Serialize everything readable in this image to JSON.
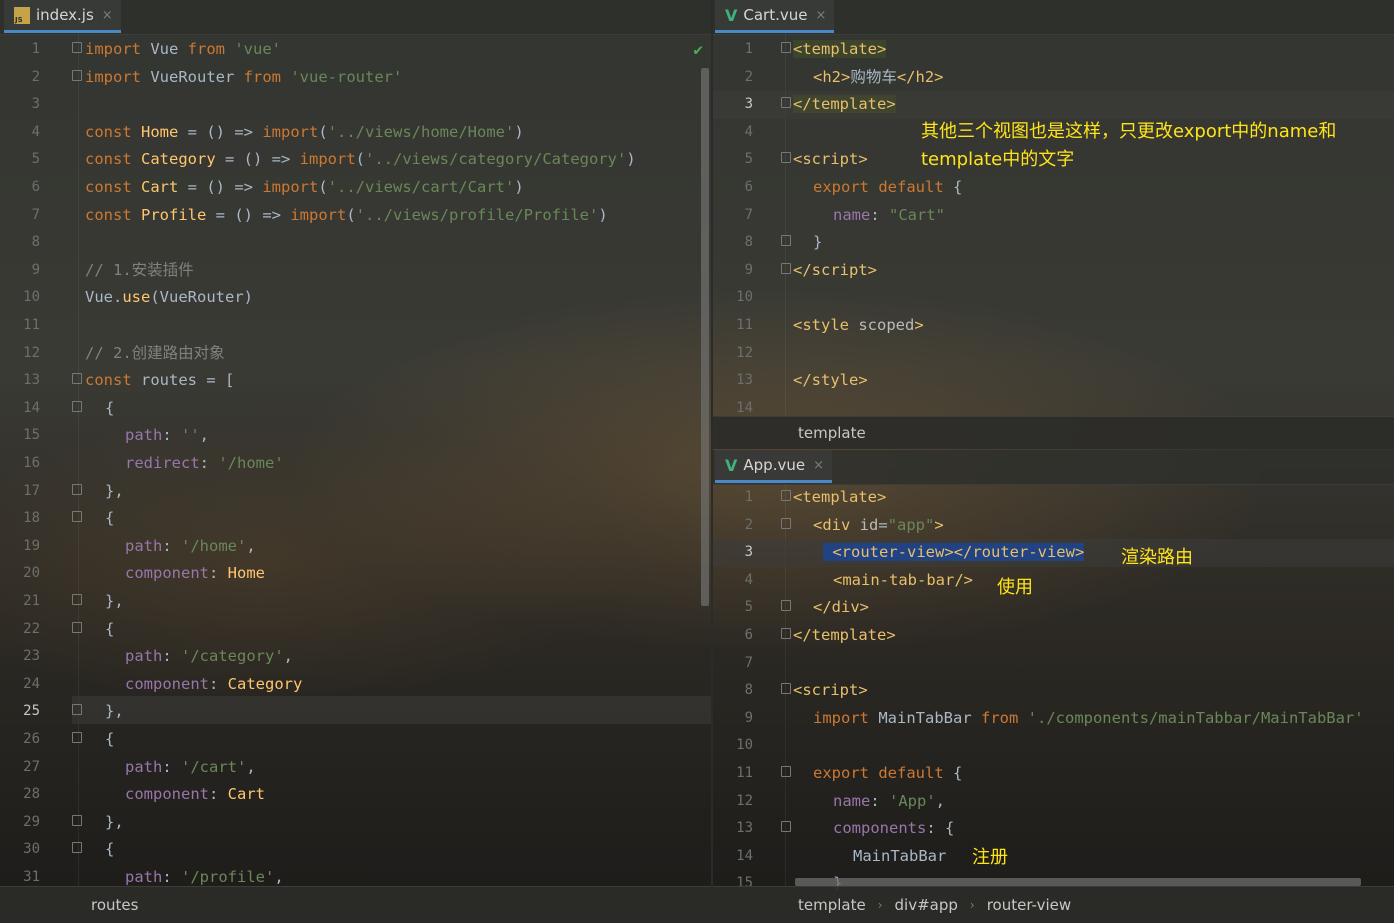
{
  "left_editor": {
    "tab": {
      "label": "index.js",
      "icon": "js-file-icon",
      "close": "×"
    },
    "lines": [
      {
        "n": "1"
      },
      {
        "n": "2"
      },
      {
        "n": "3"
      },
      {
        "n": "4"
      },
      {
        "n": "5"
      },
      {
        "n": "6"
      },
      {
        "n": "7"
      },
      {
        "n": "8"
      },
      {
        "n": "9"
      },
      {
        "n": "10"
      },
      {
        "n": "11"
      },
      {
        "n": "12"
      },
      {
        "n": "13"
      },
      {
        "n": "14"
      },
      {
        "n": "15"
      },
      {
        "n": "16"
      },
      {
        "n": "17"
      },
      {
        "n": "18"
      },
      {
        "n": "19"
      },
      {
        "n": "20"
      },
      {
        "n": "21"
      },
      {
        "n": "22"
      },
      {
        "n": "23"
      },
      {
        "n": "24"
      },
      {
        "n": "25"
      },
      {
        "n": "26"
      },
      {
        "n": "27"
      },
      {
        "n": "28"
      },
      {
        "n": "29"
      },
      {
        "n": "30"
      },
      {
        "n": "31"
      }
    ],
    "current_line": "25",
    "breadcrumb": "routes"
  },
  "cart_editor": {
    "tab": {
      "label": "Cart.vue",
      "icon": "vue-file-icon",
      "close": "×"
    },
    "lines": [
      "1",
      "2",
      "3",
      "4",
      "5",
      "6",
      "7",
      "8",
      "9",
      "10",
      "11",
      "12",
      "13",
      "14"
    ],
    "current_line": "3",
    "breadcrumb": "template",
    "annotation": [
      "其他三个视图也是这样，只更改export中的name和",
      "template中的文字"
    ]
  },
  "app_editor": {
    "tab": {
      "label": "App.vue",
      "icon": "vue-file-icon",
      "close": "×"
    },
    "lines": [
      "1",
      "2",
      "3",
      "4",
      "5",
      "6",
      "7",
      "8",
      "9",
      "10",
      "11",
      "12",
      "13",
      "14",
      "15"
    ],
    "current_line": "3",
    "breadcrumb": [
      "template",
      "div#app",
      "router-view"
    ],
    "annotations": {
      "render": "渲染路由",
      "use": "使用",
      "register": "注册"
    }
  },
  "colors": {
    "keyword": "#cc7832",
    "string": "#6a8759",
    "property": "#9876aa",
    "tag": "#e8bf6a",
    "annotation": "#ffe417",
    "selection": "#214283"
  }
}
